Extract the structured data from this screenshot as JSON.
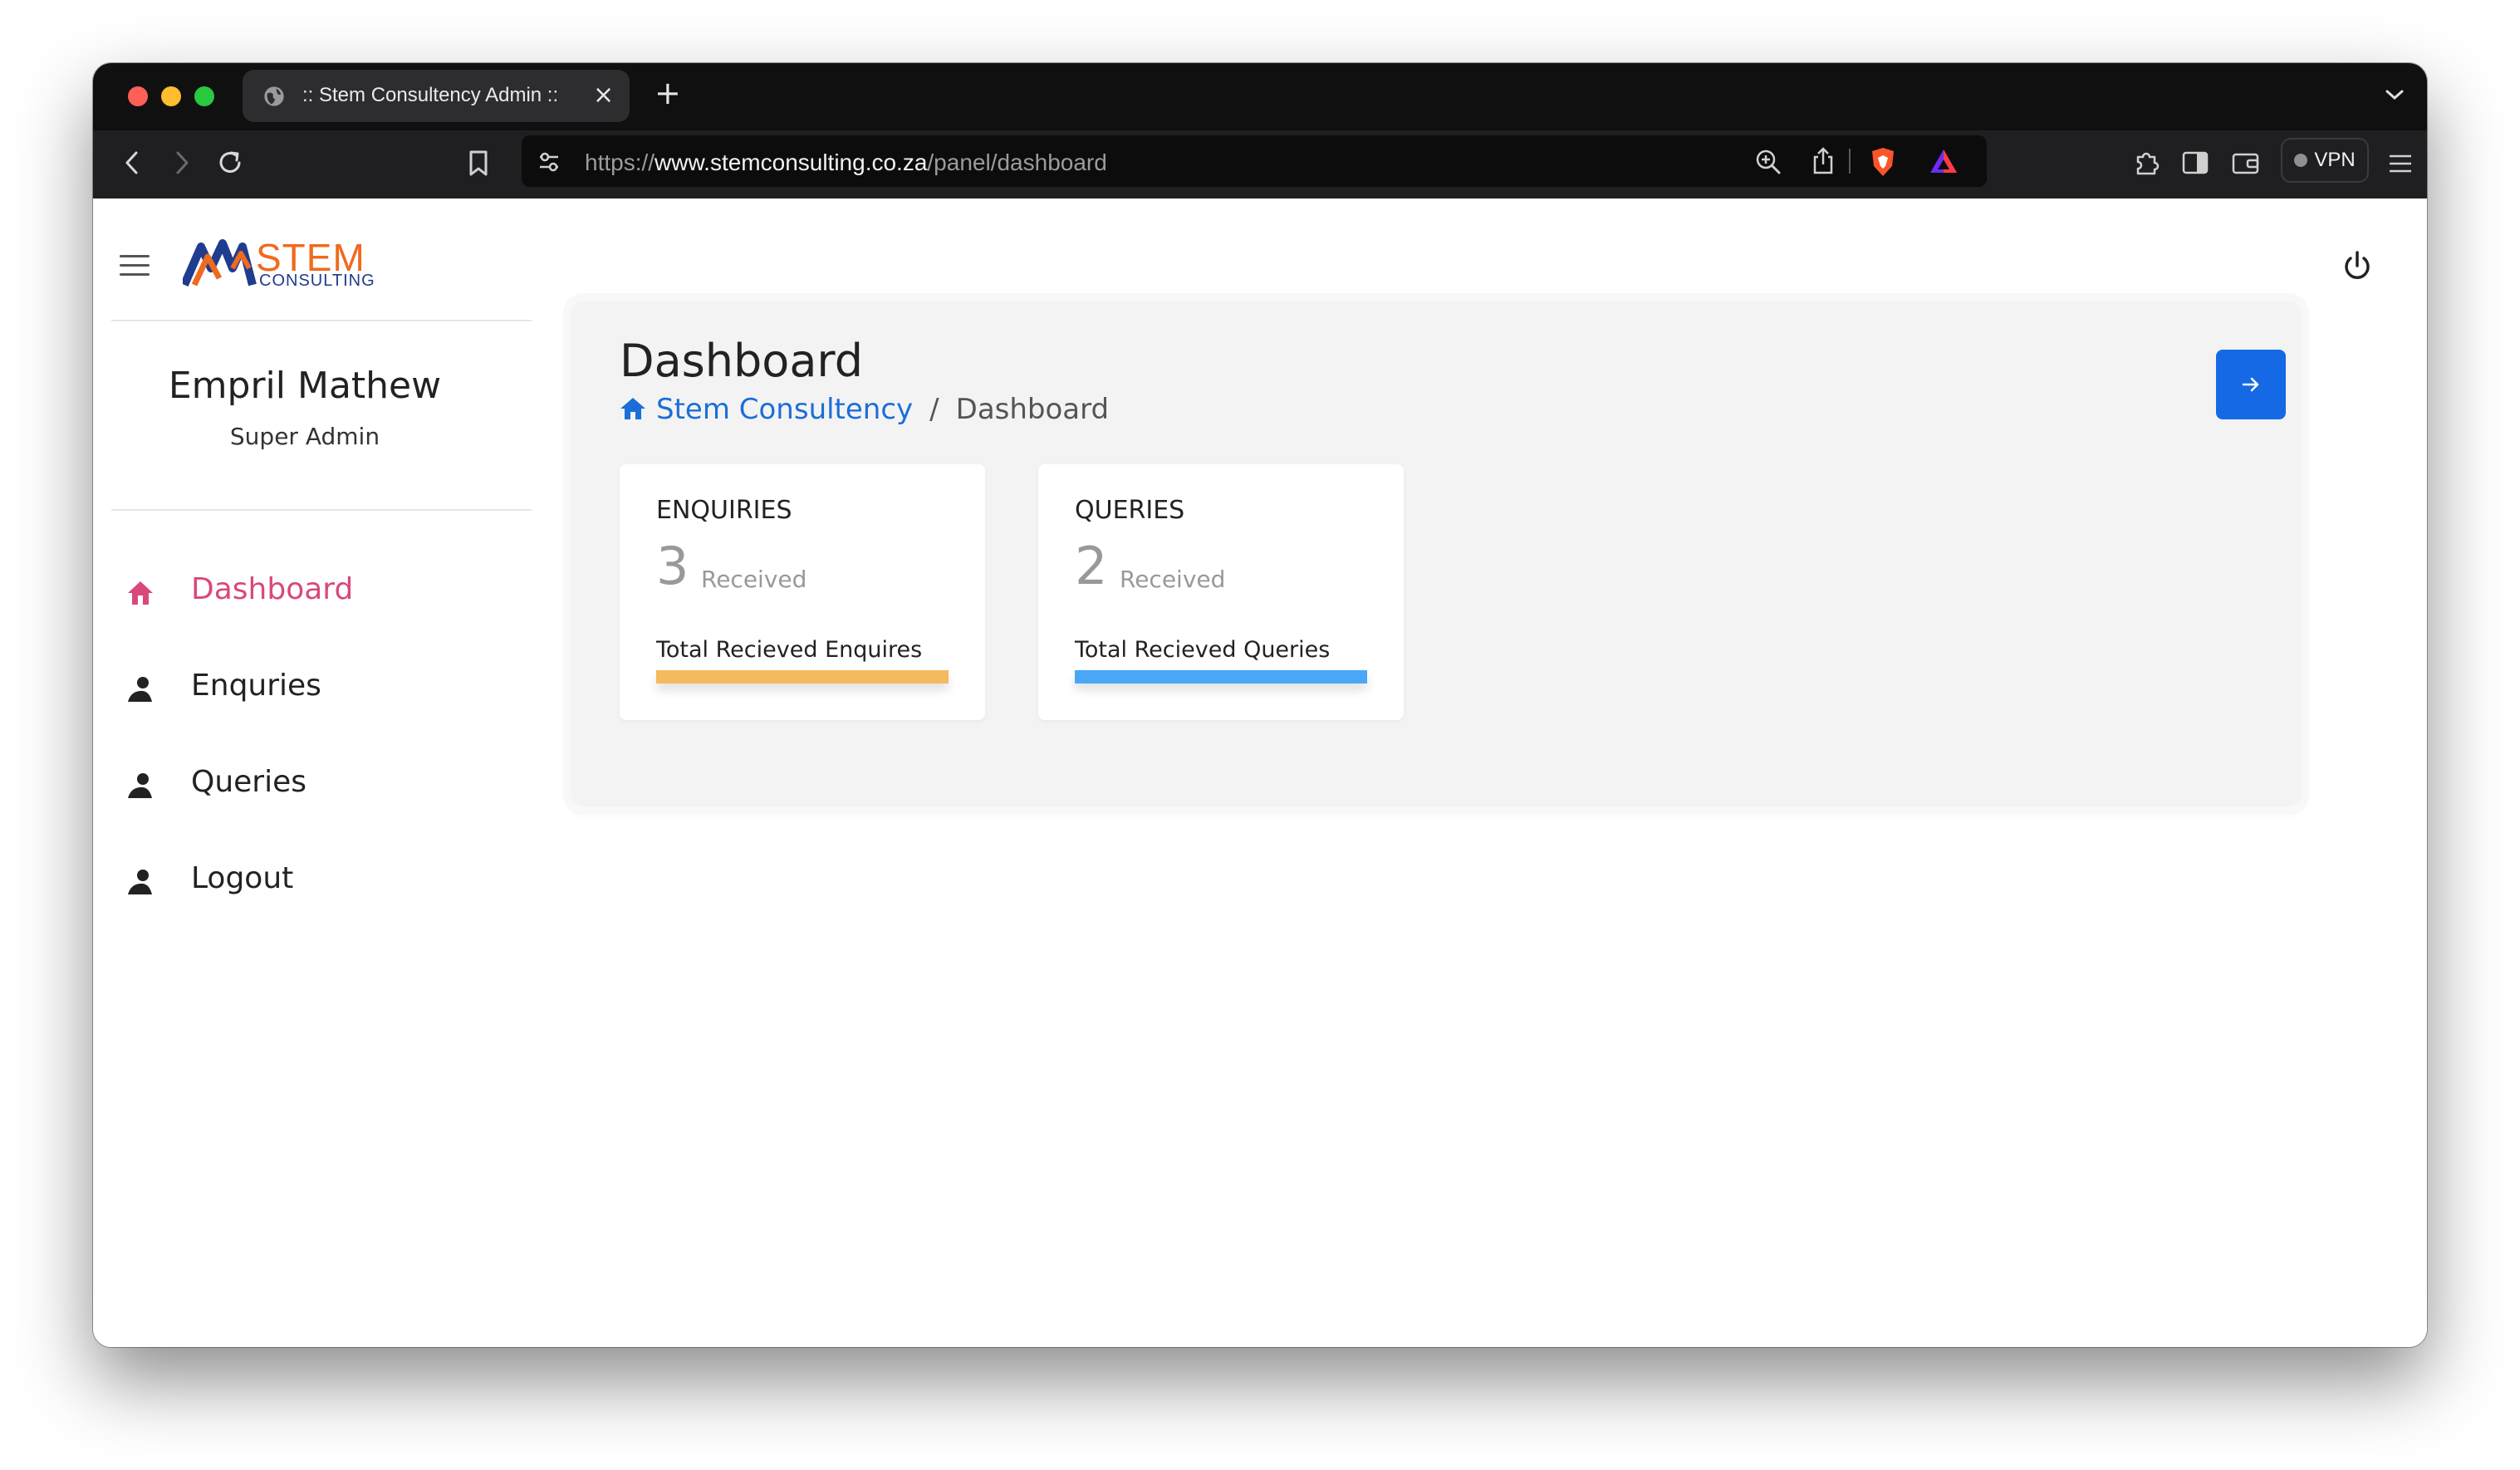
{
  "browser": {
    "tab_title": ":: Stem Consultency Admin ::",
    "url_scheme": "https://",
    "url_host": "www.stemconsulting.co.za",
    "url_path": "/panel/dashboard",
    "vpn_label": "VPN"
  },
  "sidebar": {
    "logo_text": "STEM",
    "logo_subtext": "CONSULTING",
    "user_name": "Empril Mathew",
    "user_role": "Super Admin",
    "items": [
      {
        "label": "Dashboard",
        "icon": "house-icon",
        "active": true
      },
      {
        "label": "Enquries",
        "icon": "user-icon",
        "active": false
      },
      {
        "label": "Queries",
        "icon": "user-icon",
        "active": false
      },
      {
        "label": "Logout",
        "icon": "user-icon",
        "active": false
      }
    ]
  },
  "main": {
    "title": "Dashboard",
    "breadcrumb": {
      "home": "Stem Consultency",
      "separator": "/",
      "current": "Dashboard"
    },
    "cards": [
      {
        "title": "ENQUIRIES",
        "count": "3",
        "unit": "Received",
        "description": "Total Recieved Enquires",
        "bar_color": "#f5b960"
      },
      {
        "title": "QUERIES",
        "count": "2",
        "unit": "Received",
        "description": "Total Recieved Queries",
        "bar_color": "#4aa7f5"
      }
    ]
  },
  "colors": {
    "accent": "#1669e4",
    "active_nav": "#d9487d",
    "link": "#1b6ed8"
  }
}
